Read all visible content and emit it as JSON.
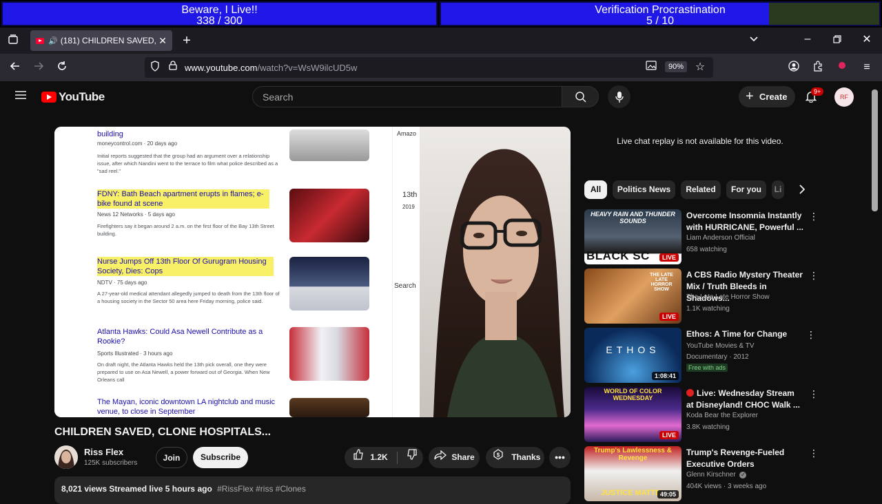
{
  "overlay": {
    "goal1": {
      "title": "Beware, I Live!!",
      "progress": "338  /  300"
    },
    "goal2": {
      "title": "Verification Procrastination",
      "progress": "5  /  10"
    }
  },
  "browser": {
    "tab_title": "(181) CHILDREN SAVED, CL",
    "url_host": "www.youtube.com",
    "url_path": "/watch?v=WsW9ilcUD5w",
    "zoom": "90%"
  },
  "youtube": {
    "logo": "YouTube",
    "search_placeholder": "Search",
    "create_label": "Create",
    "notifications_badge": "9+"
  },
  "video": {
    "screen_items": [
      {
        "title": "building",
        "source": "moneycontrol.com · 20 days ago",
        "desc": "Initial reports suggested that the group had an argument over a relationship issue, after which Nandini went to the terrace to film what police described as a \"sad reel.\""
      },
      {
        "title": "FDNY: Bath Beach apartment erupts in flames; e-bike found at scene",
        "source": "News 12 Networks · 5 days ago",
        "desc": "Firefighters say it began around 2 a.m. on the first floor of the Bay 13th Street building."
      },
      {
        "title": "Nurse Jumps Off 13th Floor Of Gurugram Housing Society, Dies: Cops",
        "source": "NDTV · 75 days ago",
        "desc": "A 27-year-old medical attendant allegedly jumped to death from the 13th floor of a housing society in the Sector 50 area here Friday morning, police said."
      },
      {
        "title": "Atlanta Hawks: Could Asa Newell Contribute as a Rookie?",
        "source": "Sports Illustrated · 3 hours ago",
        "desc": "On draft night, the Atlanta Hawks held the 13th pick overall, one they were prepared to use on Asa Newell, a power forward out of Georgia. When New Orleans call"
      },
      {
        "title": "The Mayan, iconic downtown LA nightclub and music venue, to close in September",
        "source": "",
        "desc": ""
      }
    ],
    "side_top": "Amazo",
    "side_13th": "13th",
    "side_2019": "2019",
    "side_search": "Search"
  },
  "info": {
    "title": "CHILDREN SAVED, CLONE HOSPITALS...",
    "channel": "Riss Flex",
    "subscribers": "125K subscribers",
    "join": "Join",
    "subscribe": "Subscribe",
    "likes": "1.2K",
    "share": "Share",
    "thanks": "Thanks",
    "views_line": "8,021 views  Streamed live 5 hours ago",
    "tags": "#RissFlex #riss #Clones"
  },
  "sidebar": {
    "chat_note": "Live chat replay is not available for this video.",
    "chips": [
      "All",
      "Politics News",
      "Related",
      "For you",
      "Li"
    ],
    "recs": [
      {
        "title": "Overcome Insomnia Instantly with HURRICANE, Powerful ...",
        "channel": "Liam Anderson Official",
        "meta": "658 watching",
        "badge": "LIVE",
        "thumb_top": "HEAVY RAIN AND THUNDER SOUNDS",
        "thumb_bottom": "BLACK SC"
      },
      {
        "title": "A CBS Radio Mystery Theater Mix / Truth Bleeds in Shadows...",
        "channel": "The Late Late Horror Show",
        "meta": "1.1K watching",
        "badge": "LIVE",
        "thumb_top": "THE LATE LATE HORROR SHOW"
      },
      {
        "title": "Ethos: A Time for Change",
        "channel": "YouTube Movies & TV",
        "meta": "Documentary · 2012",
        "extra": "Free with ads",
        "badge": "1:08:41",
        "thumb_top": "ETHOS"
      },
      {
        "title": "Live: Wednesday Stream at Disneyland! CHOC Walk ...",
        "channel": "Koda Bear the Explorer",
        "meta": "3.8K watching",
        "badge": "LIVE",
        "thumb_top": "WORLD OF COLOR WEDNESDAY"
      },
      {
        "title": "Trump's Revenge-Fueled Executive Orders",
        "channel": "Glenn Kirschner",
        "meta": "404K views · 3 weeks ago",
        "badge": "49:05",
        "thumb_top": "Trump's Lawlessness & Revenge",
        "thumb_bottom": "JUSTICE MATTE"
      }
    ]
  },
  "colors": {
    "goal_blue": "#2018e6",
    "yt_red": "#ff0000",
    "live_red": "#cc0000",
    "highlight": "#f8f066"
  }
}
